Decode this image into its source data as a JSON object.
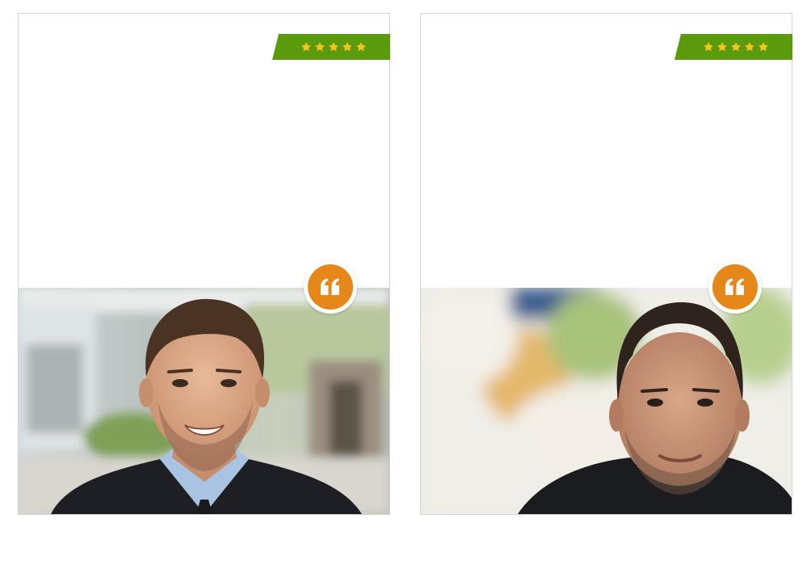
{
  "testimonials": [
    {
      "rating": 5,
      "rating_icon": "star-icon",
      "quote_icon": "quote-icon",
      "photo": "man-in-suit-portrait",
      "colors": {
        "ribbon": "#5b9a0c",
        "star": "#f5c518",
        "quote_badge": "#e6871a"
      }
    },
    {
      "rating": 5,
      "rating_icon": "star-icon",
      "quote_icon": "quote-icon",
      "photo": "man-in-black-shirt-portrait",
      "colors": {
        "ribbon": "#5b9a0c",
        "star": "#f5c518",
        "quote_badge": "#e6871a"
      }
    }
  ]
}
